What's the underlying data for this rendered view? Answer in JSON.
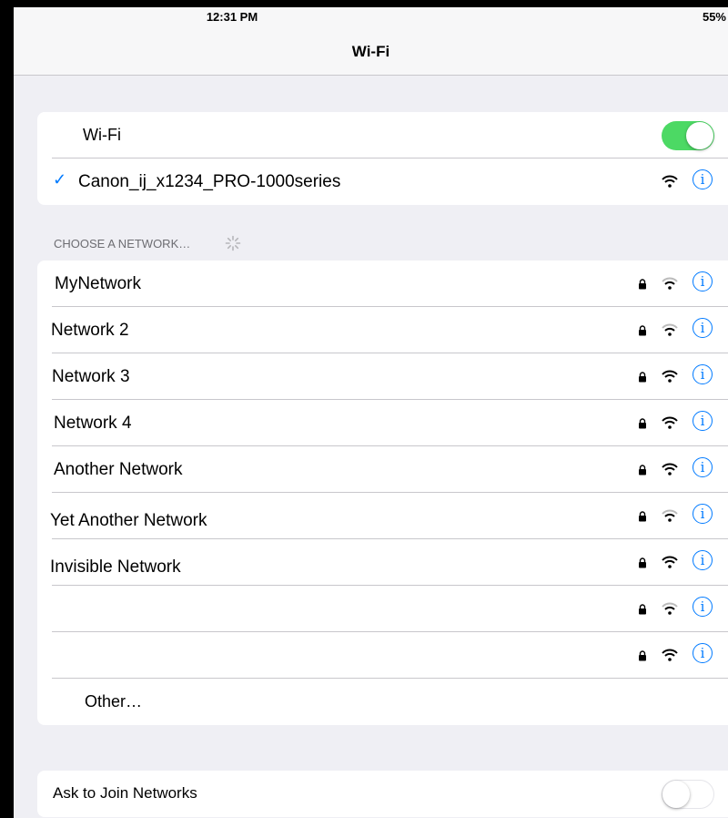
{
  "status_bar": {
    "time": "12:31 PM",
    "battery": "55%"
  },
  "nav": {
    "title": "Wi-Fi"
  },
  "wifi_toggle": {
    "label": "Wi-Fi",
    "state": "on"
  },
  "connected_network": {
    "name": "Canon_ij_x1234_PRO-1000series",
    "connected": true
  },
  "choose_header": "CHOOSE A NETWORK…",
  "networks": [
    {
      "name": "MyNetwork",
      "locked": true,
      "signal": "medium"
    },
    {
      "name": "Network 2",
      "locked": true,
      "signal": "medium"
    },
    {
      "name": "Network 3",
      "locked": true,
      "signal": "full"
    },
    {
      "name": "Network 4",
      "locked": true,
      "signal": "full"
    },
    {
      "name": "Another Network",
      "locked": true,
      "signal": "full"
    },
    {
      "name": "Yet Another Network",
      "locked": true,
      "signal": "medium"
    },
    {
      "name": "Invisible Network",
      "locked": true,
      "signal": "full"
    },
    {
      "name": "",
      "locked": true,
      "signal": "medium"
    },
    {
      "name": "",
      "locked": true,
      "signal": "full"
    }
  ],
  "other_label": "Other…",
  "ask_to_join": {
    "label": "Ask to Join Networks",
    "state": "off"
  },
  "colors": {
    "accent": "#007aff",
    "toggle_on": "#4cd964",
    "background": "#efeff4",
    "separator": "#c8c7cc"
  },
  "icons": {
    "lock": "lock-icon",
    "wifi": "wifi-signal-icon",
    "info": "info-icon",
    "check": "checkmark-icon",
    "spinner": "activity-spinner-icon"
  }
}
